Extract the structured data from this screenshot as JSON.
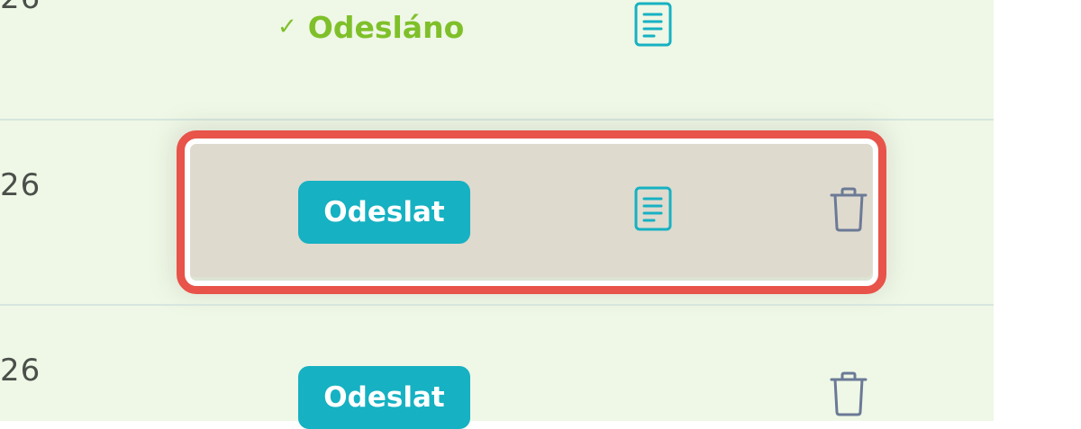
{
  "rows": [
    {
      "date_fragment": "26",
      "status": {
        "check_glyph": "✓",
        "label": "Odesláno"
      },
      "document_icon": "document-icon"
    },
    {
      "date_fragment": "26",
      "send_label": "Odeslat",
      "document_icon": "document-icon",
      "delete_icon": "trash-icon",
      "highlighted": true
    },
    {
      "date_fragment": "26",
      "send_label": "Odeslat",
      "delete_icon": "trash-icon"
    }
  ],
  "colors": {
    "panel_background": "#eff7e6",
    "accent_teal": "#16b1c2",
    "status_green": "#7fc02a",
    "highlight_red": "#e8534a",
    "icon_slate": "#6b7a96"
  }
}
